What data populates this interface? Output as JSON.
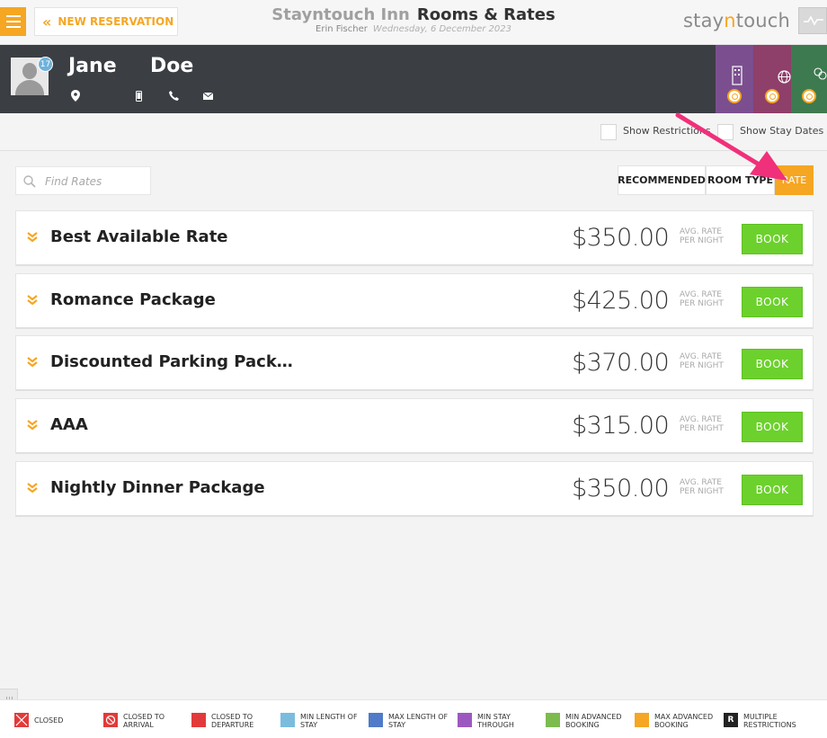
{
  "header": {
    "new_reservation": "NEW RESERVATION",
    "hotel": "Stayntouch Inn",
    "page_title": "Rooms & Rates",
    "user": "Erin Fischer",
    "date": "Wednesday, 6 December 2023",
    "brand_a": "stay",
    "brand_n": "n",
    "brand_b": "touch"
  },
  "guest": {
    "first_name": "Jane",
    "last_name": "Doe",
    "badge": "17",
    "tile_colors": [
      "#7b4f8f",
      "#8e3f6a",
      "#3e7a4f"
    ]
  },
  "options": {
    "show_restrictions": "Show Restrictions",
    "show_stay_dates": "Show Stay Dates"
  },
  "search": {
    "placeholder": "Find Rates"
  },
  "tabs": [
    "RECOMMENDED",
    "ROOM TYPE",
    "RATE"
  ],
  "active_tab": "RATE",
  "rates": [
    {
      "name": "Best Available Rate",
      "price": "$350.00",
      "avg1": "AVG. RATE",
      "avg2": "PER NIGHT",
      "book": "BOOK"
    },
    {
      "name": "Romance Package",
      "price": "$425.00",
      "avg1": "AVG. RATE",
      "avg2": "PER NIGHT",
      "book": "BOOK"
    },
    {
      "name": "Discounted Parking Pack…",
      "price": "$370.00",
      "avg1": "AVG. RATE",
      "avg2": "PER NIGHT",
      "book": "BOOK"
    },
    {
      "name": "AAA",
      "price": "$315.00",
      "avg1": "AVG. RATE",
      "avg2": "PER NIGHT",
      "book": "BOOK"
    },
    {
      "name": "Nightly Dinner Package",
      "price": "$350.00",
      "avg1": "AVG. RATE",
      "avg2": "PER NIGHT",
      "book": "BOOK"
    }
  ],
  "legend": [
    {
      "l1": "CLOSED",
      "l2": "",
      "color": "#e23a3a",
      "icon": "closed-x-icon"
    },
    {
      "l1": "CLOSED TO",
      "l2": "ARRIVAL",
      "color": "#e23a3a",
      "icon": "no-entry-icon"
    },
    {
      "l1": "CLOSED TO",
      "l2": "DEPARTURE",
      "color": "#e23a3a",
      "icon": ""
    },
    {
      "l1": "MIN LENGTH OF",
      "l2": "STAY",
      "color": "#7bbcdd",
      "icon": ""
    },
    {
      "l1": "MAX LENGTH OF",
      "l2": "STAY",
      "color": "#4f7bc8",
      "icon": ""
    },
    {
      "l1": "MIN STAY",
      "l2": "THROUGH",
      "color": "#9b59c0",
      "icon": ""
    },
    {
      "l1": "MIN ADVANCED",
      "l2": "BOOKING",
      "color": "#7dbb4f",
      "icon": ""
    },
    {
      "l1": "MAX ADVANCED",
      "l2": "BOOKING",
      "color": "#f5a623",
      "icon": ""
    },
    {
      "l1": "MULTIPLE",
      "l2": "RESTRICTIONS",
      "color": "#222222",
      "icon": "letter-r-icon",
      "glyph": "R"
    }
  ],
  "colors": {
    "accent": "#f5a623",
    "book": "#6cd12c",
    "annotation": "#f0307a"
  }
}
